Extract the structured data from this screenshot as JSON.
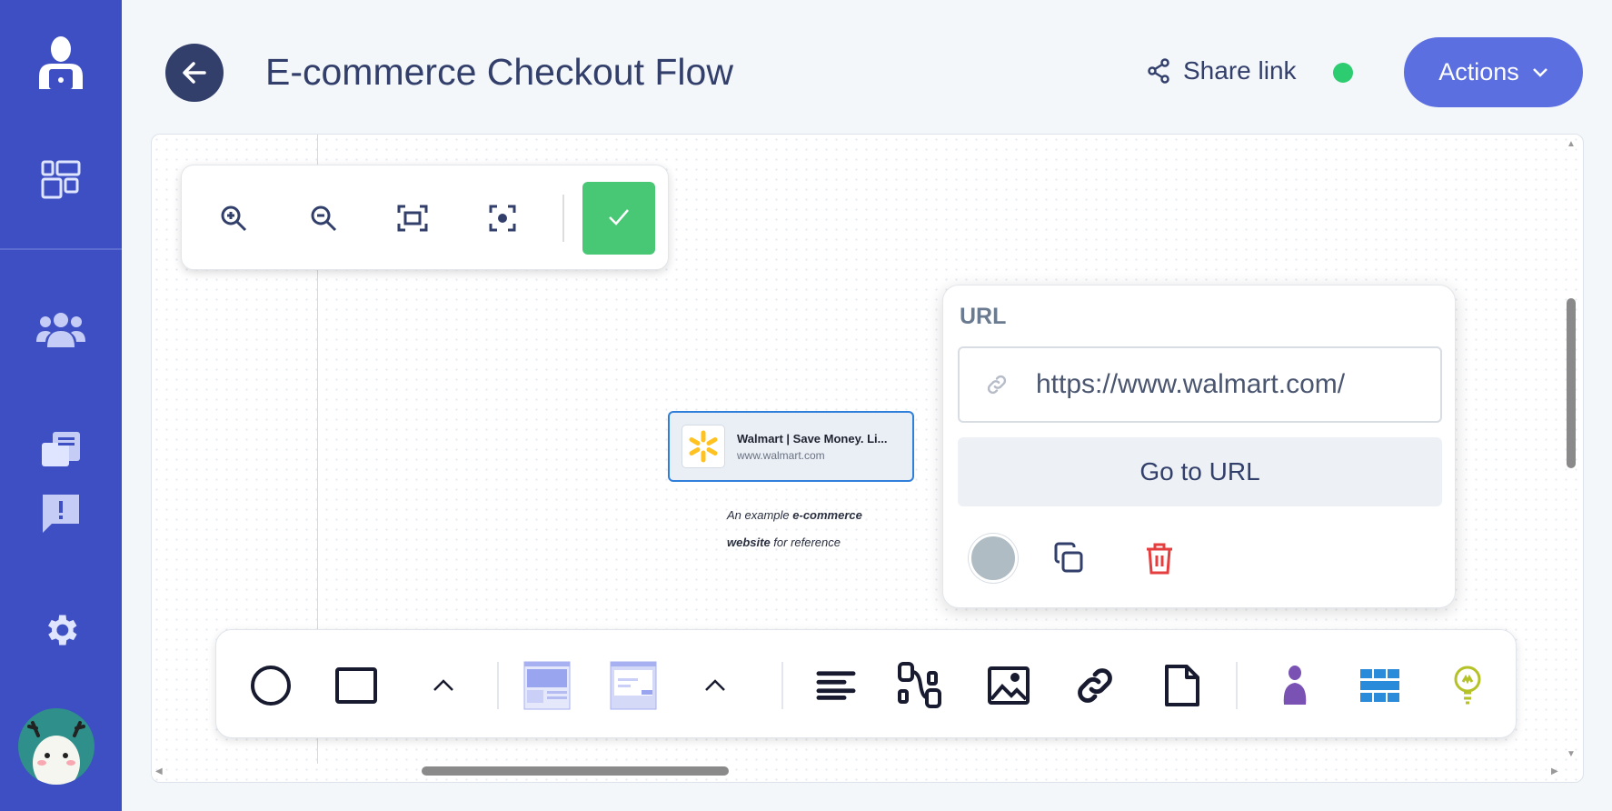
{
  "sidebar": {
    "items": [
      {
        "icon": "user-laptop-icon"
      },
      {
        "icon": "dashboard-icon"
      },
      {
        "icon": "team-icon"
      },
      {
        "icon": "documents-icon"
      },
      {
        "icon": "feedback-icon"
      },
      {
        "icon": "gear-icon"
      }
    ],
    "avatar": "deer-avatar"
  },
  "header": {
    "title": "E-commerce Checkout Flow",
    "share_label": "Share link",
    "share_status_color": "#2ecc71",
    "actions_label": "Actions"
  },
  "zoom_toolbar": {
    "tools": [
      "zoom-in-icon",
      "zoom-out-icon",
      "fit-screen-icon",
      "center-focus-icon"
    ],
    "confirm_color": "#48c774"
  },
  "link_card": {
    "title": "Walmart | Save Money. Li...",
    "url": "www.walmart.com"
  },
  "caption": {
    "part1": "An example ",
    "bold1": "e-commerce",
    "bold2": "website",
    "part2": " for reference"
  },
  "url_popup": {
    "label": "URL",
    "url_value": "https://www.walmart.com/",
    "go_label": "Go to URL",
    "color_swatch": "#b0bcc4"
  },
  "bottom_toolbar": {
    "tools": [
      "circle",
      "rectangle",
      "expand-shapes",
      "wireframe-desktop",
      "wireframe-dialog",
      "expand-wireframes",
      "text",
      "flow",
      "image",
      "link",
      "file",
      "persona",
      "table",
      "idea"
    ]
  }
}
